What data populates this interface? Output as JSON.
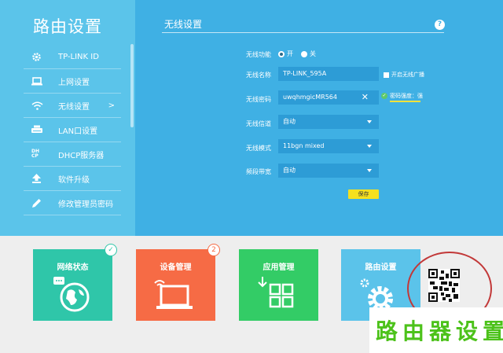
{
  "sidebar": {
    "title": "路由设置",
    "items": [
      {
        "label": "TP-LINK ID",
        "icon": "gear-icon"
      },
      {
        "label": "上网设置",
        "icon": "laptop-icon"
      },
      {
        "label": "无线设置",
        "icon": "wifi-icon",
        "chevron": ">"
      },
      {
        "label": "LAN口设置",
        "icon": "router-icon"
      },
      {
        "label": "DHCP服务器",
        "icon": "dhcp-icon",
        "icon_text": "DH\nCP"
      },
      {
        "label": "软件升级",
        "icon": "upload-arrow-icon"
      },
      {
        "label": "修改管理员密码",
        "icon": "pencil-icon"
      }
    ]
  },
  "main": {
    "title": "无线设置",
    "help": "?",
    "form": {
      "wifi_label": "无线功能",
      "on_label": "开",
      "off_label": "关",
      "ssid_label": "无线名称",
      "ssid_value": "TP-LINK_595A",
      "hide_broadcast_label": "开启无线广播",
      "password_label": "无线密码",
      "password_value": "uwqhmgicMR564",
      "clear_icon": "✕",
      "strength_label": "密码强度：强",
      "strength_ok": "✓",
      "channel_label": "无线信道",
      "channel_value": "自动",
      "mode_label": "无线模式",
      "mode_value": "11bgn mixed",
      "bandwidth_label": "频段带宽",
      "bandwidth_value": "自动",
      "save_label": "保存"
    }
  },
  "tiles": [
    {
      "label": "网络状态",
      "icon": "globe-chat-icon",
      "badge": "✓"
    },
    {
      "label": "设备管理",
      "icon": "laptop-wifi-icon",
      "badge": "2"
    },
    {
      "label": "应用管理",
      "icon": "apps-grid-icon"
    },
    {
      "label": "路由设置",
      "icon": "gear-icon"
    }
  ],
  "watermark": "路由器设置",
  "colors": {
    "sidebar": "#5bc4ea",
    "main": "#3fb0e4",
    "field": "#2d9cd6",
    "save": "#f5e01e",
    "tile_net": "#2fc6a9",
    "tile_dev": "#f66b45",
    "tile_app": "#33cc66",
    "tile_router": "#5bc3ea",
    "watermark": "#4cc21a",
    "circle": "#c23838"
  }
}
